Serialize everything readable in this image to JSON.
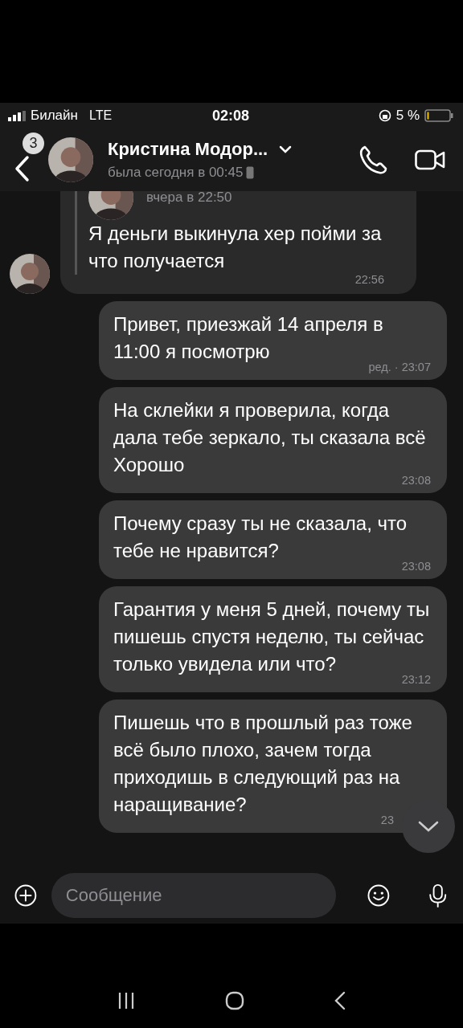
{
  "status_bar": {
    "carrier": "Билайн",
    "network": "LTE",
    "time": "02:08",
    "battery": "5 %"
  },
  "header": {
    "unread_badge": "3",
    "name": "Кристина Модор...",
    "last_seen": "была сегодня в 00:45"
  },
  "messages": [
    {
      "kind": "incoming",
      "quote_time": "вчера в 22:50",
      "text": "Я деньги выкинула хер пойми за что получается",
      "time": "22:56"
    },
    {
      "kind": "outgoing",
      "text": "Привет, приезжай 14 апреля в 11:00 я посмотрю",
      "time": "ред. · 23:07"
    },
    {
      "kind": "outgoing",
      "text": "На склейки я проверила, когда дала тебе зеркало, ты сказала всё Хорошо",
      "time": "23:08"
    },
    {
      "kind": "outgoing",
      "text": "Почему сразу ты не сказала, что тебе не нравится?",
      "time": "23:08"
    },
    {
      "kind": "outgoing",
      "text": "Гарантия у меня 5 дней, почему ты пишешь спустя неделю, ты сейчас только увидела или что?",
      "time": "23:12"
    },
    {
      "kind": "outgoing",
      "text": "Пишешь что в прошлый раз тоже всё было плохо, зачем тогда приходишь в следующий раз на наращивание?",
      "time": "23"
    }
  ],
  "composer": {
    "placeholder": "Сообщение"
  }
}
